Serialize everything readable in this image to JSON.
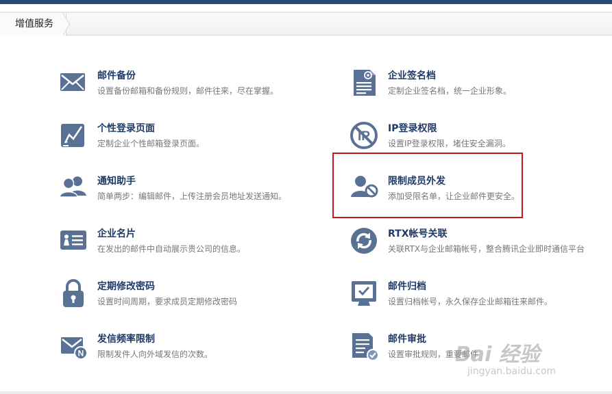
{
  "breadcrumb": {
    "label": "增值服务"
  },
  "services_left": [
    {
      "title": "邮件备份",
      "desc": "设置备份邮箱和备份规则，邮件往来，尽在掌握。",
      "icon": "envelope-icon"
    },
    {
      "title": "个性登录页面",
      "desc": "定制企业个性邮箱登录页面。",
      "icon": "edit-page-icon"
    },
    {
      "title": "通知助手",
      "desc": "简单两步：编辑邮件，上传注册会员地址发送通知。",
      "icon": "users-icon"
    },
    {
      "title": "企业名片",
      "desc": "在发出的邮件中自动展示贵公司的信息。",
      "icon": "business-card-icon"
    },
    {
      "title": "定期修改密码",
      "desc": "设置时间周期，要求成员定期修改密码",
      "icon": "lock-icon"
    },
    {
      "title": "发信频率限制",
      "desc": "限制发件人向外域发信的次数。",
      "icon": "mail-limit-icon"
    }
  ],
  "services_right": [
    {
      "title": "企业签名档",
      "desc": "定制企业签名档，统一企业形象。",
      "icon": "signature-doc-icon"
    },
    {
      "title": "IP登录权限",
      "desc": "设置IP登录权限，堵住安全漏洞。",
      "icon": "ip-forbidden-icon"
    },
    {
      "title": "限制成员外发",
      "desc": "添加受限名单，让企业邮件更安全。",
      "icon": "user-block-icon"
    },
    {
      "title": "RTX帐号关联",
      "desc": "关联RTX与企业邮箱帐号，整合腾讯企业即时通信平台",
      "icon": "sync-icon"
    },
    {
      "title": "邮件归档",
      "desc": "设置归档帐号，永久保存企业邮箱往来邮件。",
      "icon": "archive-icon"
    },
    {
      "title": "邮件审批",
      "desc": "设置审批规则，重要邮件",
      "icon": "approval-doc-icon"
    }
  ],
  "watermark": {
    "logo": "Bai 经验",
    "url": "jingyan.baidu.com"
  },
  "colors": {
    "title": "#1f3a66",
    "icon": "#5a7196",
    "highlight": "#c8161d",
    "topbar": "#2b4a74"
  }
}
